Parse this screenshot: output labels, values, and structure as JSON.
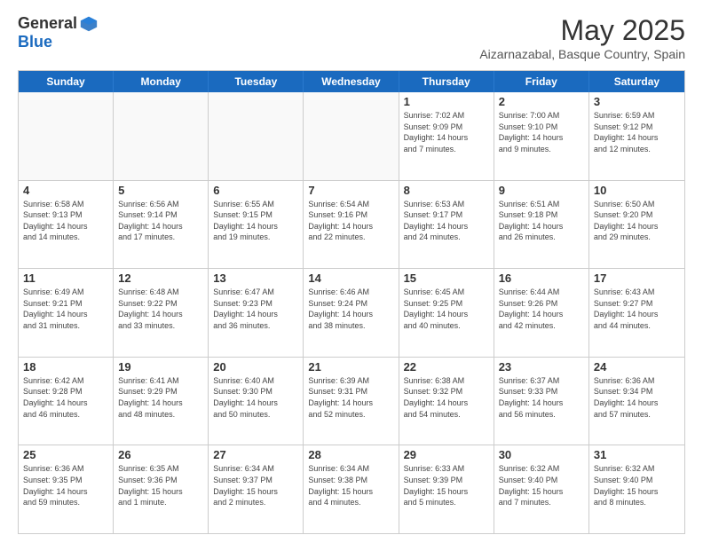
{
  "header": {
    "logo_general": "General",
    "logo_blue": "Blue",
    "month": "May 2025",
    "location": "Aizarnazabal, Basque Country, Spain"
  },
  "weekdays": [
    "Sunday",
    "Monday",
    "Tuesday",
    "Wednesday",
    "Thursday",
    "Friday",
    "Saturday"
  ],
  "rows": [
    [
      {
        "date": "",
        "info": ""
      },
      {
        "date": "",
        "info": ""
      },
      {
        "date": "",
        "info": ""
      },
      {
        "date": "",
        "info": ""
      },
      {
        "date": "1",
        "info": "Sunrise: 7:02 AM\nSunset: 9:09 PM\nDaylight: 14 hours\nand 7 minutes."
      },
      {
        "date": "2",
        "info": "Sunrise: 7:00 AM\nSunset: 9:10 PM\nDaylight: 14 hours\nand 9 minutes."
      },
      {
        "date": "3",
        "info": "Sunrise: 6:59 AM\nSunset: 9:12 PM\nDaylight: 14 hours\nand 12 minutes."
      }
    ],
    [
      {
        "date": "4",
        "info": "Sunrise: 6:58 AM\nSunset: 9:13 PM\nDaylight: 14 hours\nand 14 minutes."
      },
      {
        "date": "5",
        "info": "Sunrise: 6:56 AM\nSunset: 9:14 PM\nDaylight: 14 hours\nand 17 minutes."
      },
      {
        "date": "6",
        "info": "Sunrise: 6:55 AM\nSunset: 9:15 PM\nDaylight: 14 hours\nand 19 minutes."
      },
      {
        "date": "7",
        "info": "Sunrise: 6:54 AM\nSunset: 9:16 PM\nDaylight: 14 hours\nand 22 minutes."
      },
      {
        "date": "8",
        "info": "Sunrise: 6:53 AM\nSunset: 9:17 PM\nDaylight: 14 hours\nand 24 minutes."
      },
      {
        "date": "9",
        "info": "Sunrise: 6:51 AM\nSunset: 9:18 PM\nDaylight: 14 hours\nand 26 minutes."
      },
      {
        "date": "10",
        "info": "Sunrise: 6:50 AM\nSunset: 9:20 PM\nDaylight: 14 hours\nand 29 minutes."
      }
    ],
    [
      {
        "date": "11",
        "info": "Sunrise: 6:49 AM\nSunset: 9:21 PM\nDaylight: 14 hours\nand 31 minutes."
      },
      {
        "date": "12",
        "info": "Sunrise: 6:48 AM\nSunset: 9:22 PM\nDaylight: 14 hours\nand 33 minutes."
      },
      {
        "date": "13",
        "info": "Sunrise: 6:47 AM\nSunset: 9:23 PM\nDaylight: 14 hours\nand 36 minutes."
      },
      {
        "date": "14",
        "info": "Sunrise: 6:46 AM\nSunset: 9:24 PM\nDaylight: 14 hours\nand 38 minutes."
      },
      {
        "date": "15",
        "info": "Sunrise: 6:45 AM\nSunset: 9:25 PM\nDaylight: 14 hours\nand 40 minutes."
      },
      {
        "date": "16",
        "info": "Sunrise: 6:44 AM\nSunset: 9:26 PM\nDaylight: 14 hours\nand 42 minutes."
      },
      {
        "date": "17",
        "info": "Sunrise: 6:43 AM\nSunset: 9:27 PM\nDaylight: 14 hours\nand 44 minutes."
      }
    ],
    [
      {
        "date": "18",
        "info": "Sunrise: 6:42 AM\nSunset: 9:28 PM\nDaylight: 14 hours\nand 46 minutes."
      },
      {
        "date": "19",
        "info": "Sunrise: 6:41 AM\nSunset: 9:29 PM\nDaylight: 14 hours\nand 48 minutes."
      },
      {
        "date": "20",
        "info": "Sunrise: 6:40 AM\nSunset: 9:30 PM\nDaylight: 14 hours\nand 50 minutes."
      },
      {
        "date": "21",
        "info": "Sunrise: 6:39 AM\nSunset: 9:31 PM\nDaylight: 14 hours\nand 52 minutes."
      },
      {
        "date": "22",
        "info": "Sunrise: 6:38 AM\nSunset: 9:32 PM\nDaylight: 14 hours\nand 54 minutes."
      },
      {
        "date": "23",
        "info": "Sunrise: 6:37 AM\nSunset: 9:33 PM\nDaylight: 14 hours\nand 56 minutes."
      },
      {
        "date": "24",
        "info": "Sunrise: 6:36 AM\nSunset: 9:34 PM\nDaylight: 14 hours\nand 57 minutes."
      }
    ],
    [
      {
        "date": "25",
        "info": "Sunrise: 6:36 AM\nSunset: 9:35 PM\nDaylight: 14 hours\nand 59 minutes."
      },
      {
        "date": "26",
        "info": "Sunrise: 6:35 AM\nSunset: 9:36 PM\nDaylight: 15 hours\nand 1 minute."
      },
      {
        "date": "27",
        "info": "Sunrise: 6:34 AM\nSunset: 9:37 PM\nDaylight: 15 hours\nand 2 minutes."
      },
      {
        "date": "28",
        "info": "Sunrise: 6:34 AM\nSunset: 9:38 PM\nDaylight: 15 hours\nand 4 minutes."
      },
      {
        "date": "29",
        "info": "Sunrise: 6:33 AM\nSunset: 9:39 PM\nDaylight: 15 hours\nand 5 minutes."
      },
      {
        "date": "30",
        "info": "Sunrise: 6:32 AM\nSunset: 9:40 PM\nDaylight: 15 hours\nand 7 minutes."
      },
      {
        "date": "31",
        "info": "Sunrise: 6:32 AM\nSunset: 9:40 PM\nDaylight: 15 hours\nand 8 minutes."
      }
    ]
  ]
}
